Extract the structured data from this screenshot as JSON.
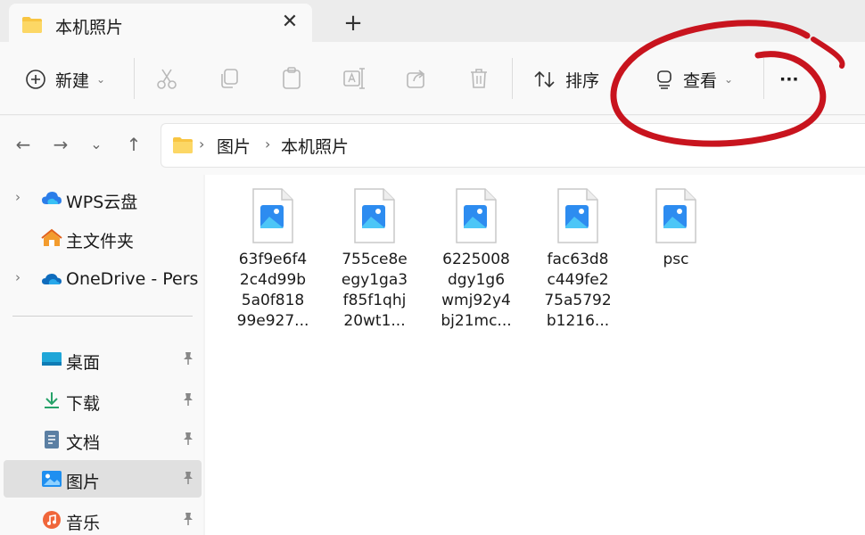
{
  "tab": {
    "title": "本机照片",
    "close": "✕",
    "new_tab": "+"
  },
  "toolbar": {
    "new_label": "新建",
    "sort_label": "排序",
    "view_label": "查看",
    "more": "···",
    "chevron": "⌄"
  },
  "nav": {
    "back": "←",
    "forward": "→",
    "recent": "⌄",
    "up": "↑"
  },
  "breadcrumb": {
    "parts": [
      "图片",
      "本机照片"
    ],
    "sep": "›"
  },
  "sidebar": {
    "items": [
      {
        "label": "WPS云盘",
        "icon": "cloud-icon",
        "expandable": true
      },
      {
        "label": "主文件夹",
        "icon": "home-icon",
        "expandable": false
      },
      {
        "label": "OneDrive - Pers",
        "icon": "onedrive-icon",
        "expandable": true
      },
      {
        "label": "桌面",
        "icon": "desktop-icon",
        "pinned": true
      },
      {
        "label": "下载",
        "icon": "download-icon",
        "pinned": true
      },
      {
        "label": "文档",
        "icon": "document-icon",
        "pinned": true
      },
      {
        "label": "图片",
        "icon": "pictures-icon",
        "pinned": true,
        "selected": true
      },
      {
        "label": "音乐",
        "icon": "music-icon",
        "pinned": true
      }
    ],
    "expand_glyph": "›",
    "pin_glyph": "📌"
  },
  "files": [
    {
      "lines": [
        "63f9e6f4",
        "2c4d99b",
        "5a0f818",
        "99e927..."
      ]
    },
    {
      "lines": [
        "755ce8e",
        "egy1ga3",
        "f85f1qhj",
        "20wt1..."
      ]
    },
    {
      "lines": [
        "6225008",
        "dgy1g6",
        "wmj92y4",
        "bj21mc..."
      ]
    },
    {
      "lines": [
        "fac63d8",
        "c449fe2",
        "75a5792",
        "b1216..."
      ]
    },
    {
      "lines": [
        "psc"
      ]
    }
  ],
  "colors": {
    "accent": "#1a73e8",
    "folder": "#f8c542",
    "annotation": "#c8141e",
    "selected_bg": "#e0e0e0"
  }
}
